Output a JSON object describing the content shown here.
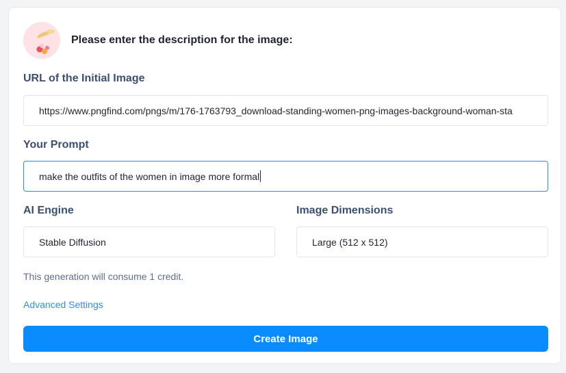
{
  "header": {
    "title": "Please enter the description for the image:"
  },
  "url_section": {
    "label": "URL of the Initial Image",
    "value": "https://www.pngfind.com/pngs/m/176-1763793_download-standing-women-png-images-background-woman-sta"
  },
  "prompt_section": {
    "label": "Your Prompt",
    "value": "make the outfits of the women in image more formal"
  },
  "engine_section": {
    "label": "AI Engine",
    "value": "Stable Diffusion"
  },
  "dimensions_section": {
    "label": "Image Dimensions",
    "value": "Large (512 x 512)"
  },
  "note": "This generation will consume 1 credit.",
  "advanced_link": "Advanced Settings",
  "create_button": "Create Image",
  "colors": {
    "accent": "#0a8cff",
    "label": "#3b4f73",
    "link": "#2d8ff0",
    "focus_border": "#2b8df0"
  }
}
